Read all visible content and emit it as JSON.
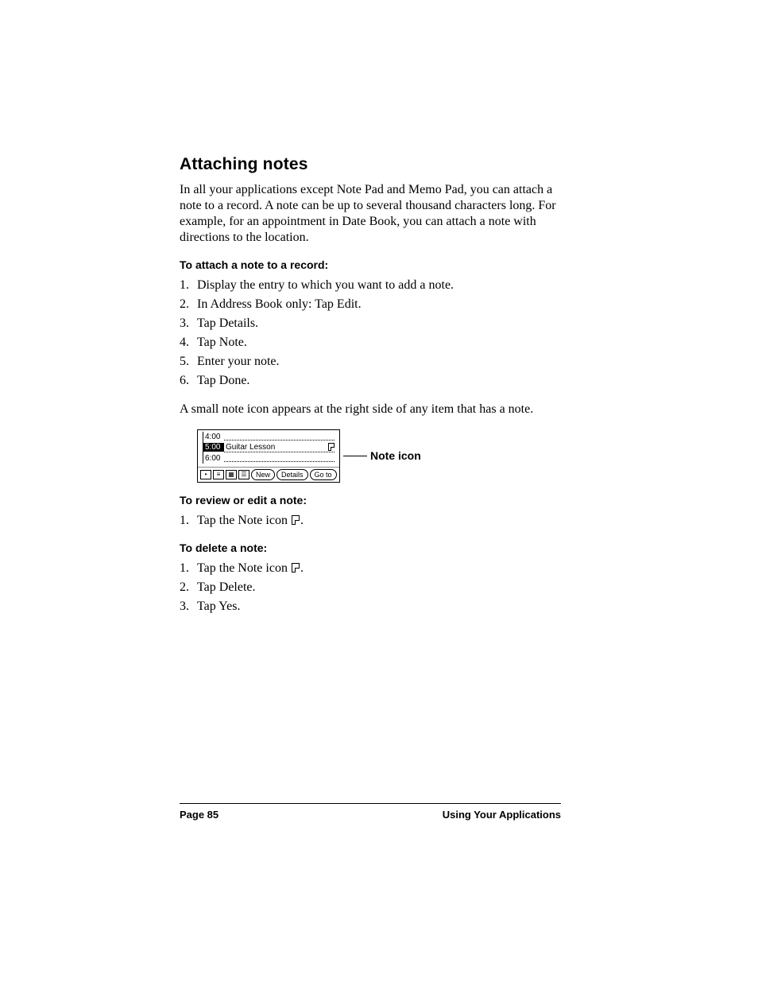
{
  "section_title": "Attaching notes",
  "intro": "In all your applications except Note Pad and Memo Pad, you can attach a note to a record. A note can be up to several thousand characters long. For example, for an appointment in Date Book, you can attach a note with directions to the location.",
  "attach": {
    "heading": "To attach a note to a record:",
    "steps": [
      "Display the entry to which you want to add a note.",
      "In Address Book only: Tap Edit.",
      "Tap Details.",
      "Tap Note.",
      "Enter your note.",
      "Tap Done."
    ]
  },
  "after_steps": "A small note icon appears at the right side of any item that has a note.",
  "figure": {
    "rows": [
      {
        "time": "4:00",
        "text": "",
        "highlight": false,
        "note": false
      },
      {
        "time": "5:00",
        "text": "Guitar Lesson",
        "highlight": true,
        "note": true
      },
      {
        "time": "6:00",
        "text": "",
        "highlight": false,
        "note": false
      }
    ],
    "buttons": [
      "New",
      "Details",
      "Go to"
    ],
    "callout": "Note icon"
  },
  "review": {
    "heading": "To review or edit a note:",
    "steps_prefix": [
      "Tap the Note icon "
    ],
    "steps_suffix": [
      "."
    ]
  },
  "delete": {
    "heading": "To delete a note:",
    "step1_prefix": "Tap the Note icon ",
    "step1_suffix": ".",
    "steps_rest": [
      "Tap Delete.",
      "Tap Yes."
    ]
  },
  "footer": {
    "left": "Page 85",
    "right": "Using Your Applications"
  }
}
